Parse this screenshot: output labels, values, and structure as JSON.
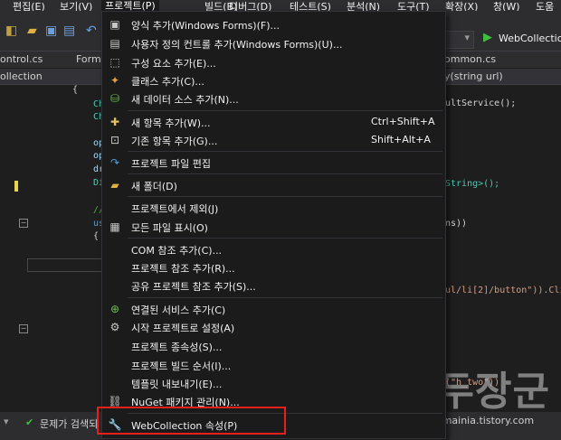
{
  "menubar": {
    "items": [
      "편집(E)",
      "보기(V)",
      "프로젝트(P)",
      "빌드(B)",
      "디버그(D)",
      "테스트(S)",
      "분석(N)",
      "도구(T)",
      "확장(X)",
      "창(W)",
      "도움"
    ]
  },
  "toolbar": {
    "run_target": "WebCollection"
  },
  "tabs": [
    "ontrol.cs",
    "Form",
    "ommon.cs"
  ],
  "navbar": {
    "left": "ollection",
    "right": "y(string url)"
  },
  "code_lines": [
    "{",
    "Ch",
    "Ch",
    "op",
    "op",
    "dr",
    "Di",
    "//",
    "us",
    "{",
    "ultService();",
    "String>();",
    "ns))",
    "ul/li[2]/button\")).Cli",
    "(\"h_two\"))"
  ],
  "dropdown": {
    "items": [
      {
        "icon": "form-icon",
        "label": "양식 추가(Windows Forms)(F)..."
      },
      {
        "icon": "usercontrol-icon",
        "label": "사용자 정의 컨트롤 추가(Windows Forms)(U)..."
      },
      {
        "icon": "component-icon",
        "label": "구성 요소 추가(E)..."
      },
      {
        "icon": "class-icon",
        "label": "클래스 추가(C)..."
      },
      {
        "icon": "datasource-icon",
        "label": "새 데이터 소스 추가(N)..."
      },
      {
        "icon": "new-item-icon",
        "label": "새 항목 추가(W)...",
        "shortcut": "Ctrl+Shift+A"
      },
      {
        "icon": "existing-item-icon",
        "label": "기존 항목 추가(G)...",
        "shortcut": "Shift+Alt+A"
      },
      {
        "icon": "edit-project-icon",
        "label": "프로젝트 파일 편집"
      },
      {
        "icon": "new-folder-icon",
        "label": "새 폴더(D)"
      },
      {
        "icon": "",
        "label": "프로젝트에서 제외(J)"
      },
      {
        "icon": "show-all-files-icon",
        "label": "모든 파일 표시(O)"
      },
      {
        "icon": "",
        "label": "COM 참조 추가(C)..."
      },
      {
        "icon": "",
        "label": "프로젝트 참조 추가(R)..."
      },
      {
        "icon": "",
        "label": "공유 프로젝트 참조 추가(S)..."
      },
      {
        "icon": "connected-service-icon",
        "label": "연결된 서비스 추가(C)"
      },
      {
        "icon": "gear-icon",
        "label": "시작 프로젝트로 설정(A)"
      },
      {
        "icon": "",
        "label": "프로젝트 종속성(S)..."
      },
      {
        "icon": "",
        "label": "프로젝트 빌드 순서(I)..."
      },
      {
        "icon": "",
        "label": "템플릿 내보내기(E)..."
      },
      {
        "icon": "nuget-icon",
        "label": "NuGet 패키지 관리(N)..."
      },
      {
        "icon": "wrench-icon",
        "label": "WebCollection 속성(P)"
      }
    ]
  },
  "status": {
    "problems": "문제가 검색되"
  },
  "watermark": {
    "big": "녹두장군",
    "url": "http://mainia.tistory.com"
  },
  "colors": {
    "highlight_box": "#e8201c",
    "menu_bg": "#1b1b1c",
    "run_green": "#3fbf3f"
  }
}
